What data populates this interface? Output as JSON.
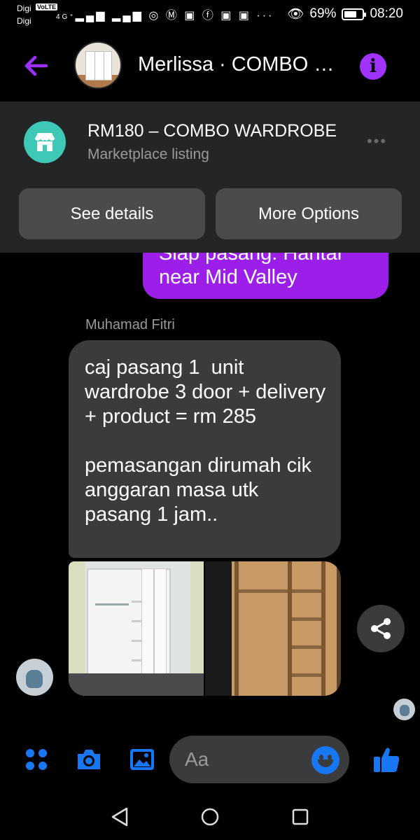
{
  "status_bar": {
    "carrier_1": "Digi",
    "carrier_2": "Digi",
    "volte": "VoLTE",
    "network": "4G⁺",
    "battery": "69%",
    "battery_level": 0.69,
    "time": "08:20"
  },
  "header": {
    "title": "Merlissa · COMBO WARDROBE",
    "back_icon": "back-arrow-icon",
    "info_icon": "info-icon"
  },
  "listing": {
    "title": "RM180 – COMBO WARDROBE",
    "subtitle": "Marketplace listing",
    "see_details_label": "See details",
    "more_options_label": "More Options"
  },
  "conversation": {
    "sent_message_partial": "Siap pasang. Hantar near Mid Valley",
    "sender_name": "Muhamad Fitri",
    "received_message": "caj pasang 1  unit wardrobe 3 door + delivery + product = rm 285\n\npemasangan dirumah cik anggaran masa utk pasang 1 jam..",
    "photos": [
      "white-3-door-wardrobe-photo",
      "wooden-wardrobe-interior-photo"
    ]
  },
  "composer": {
    "placeholder": "Aa",
    "colors": {
      "accent": "#1877f2",
      "brand_purple": "#a033ff"
    }
  }
}
